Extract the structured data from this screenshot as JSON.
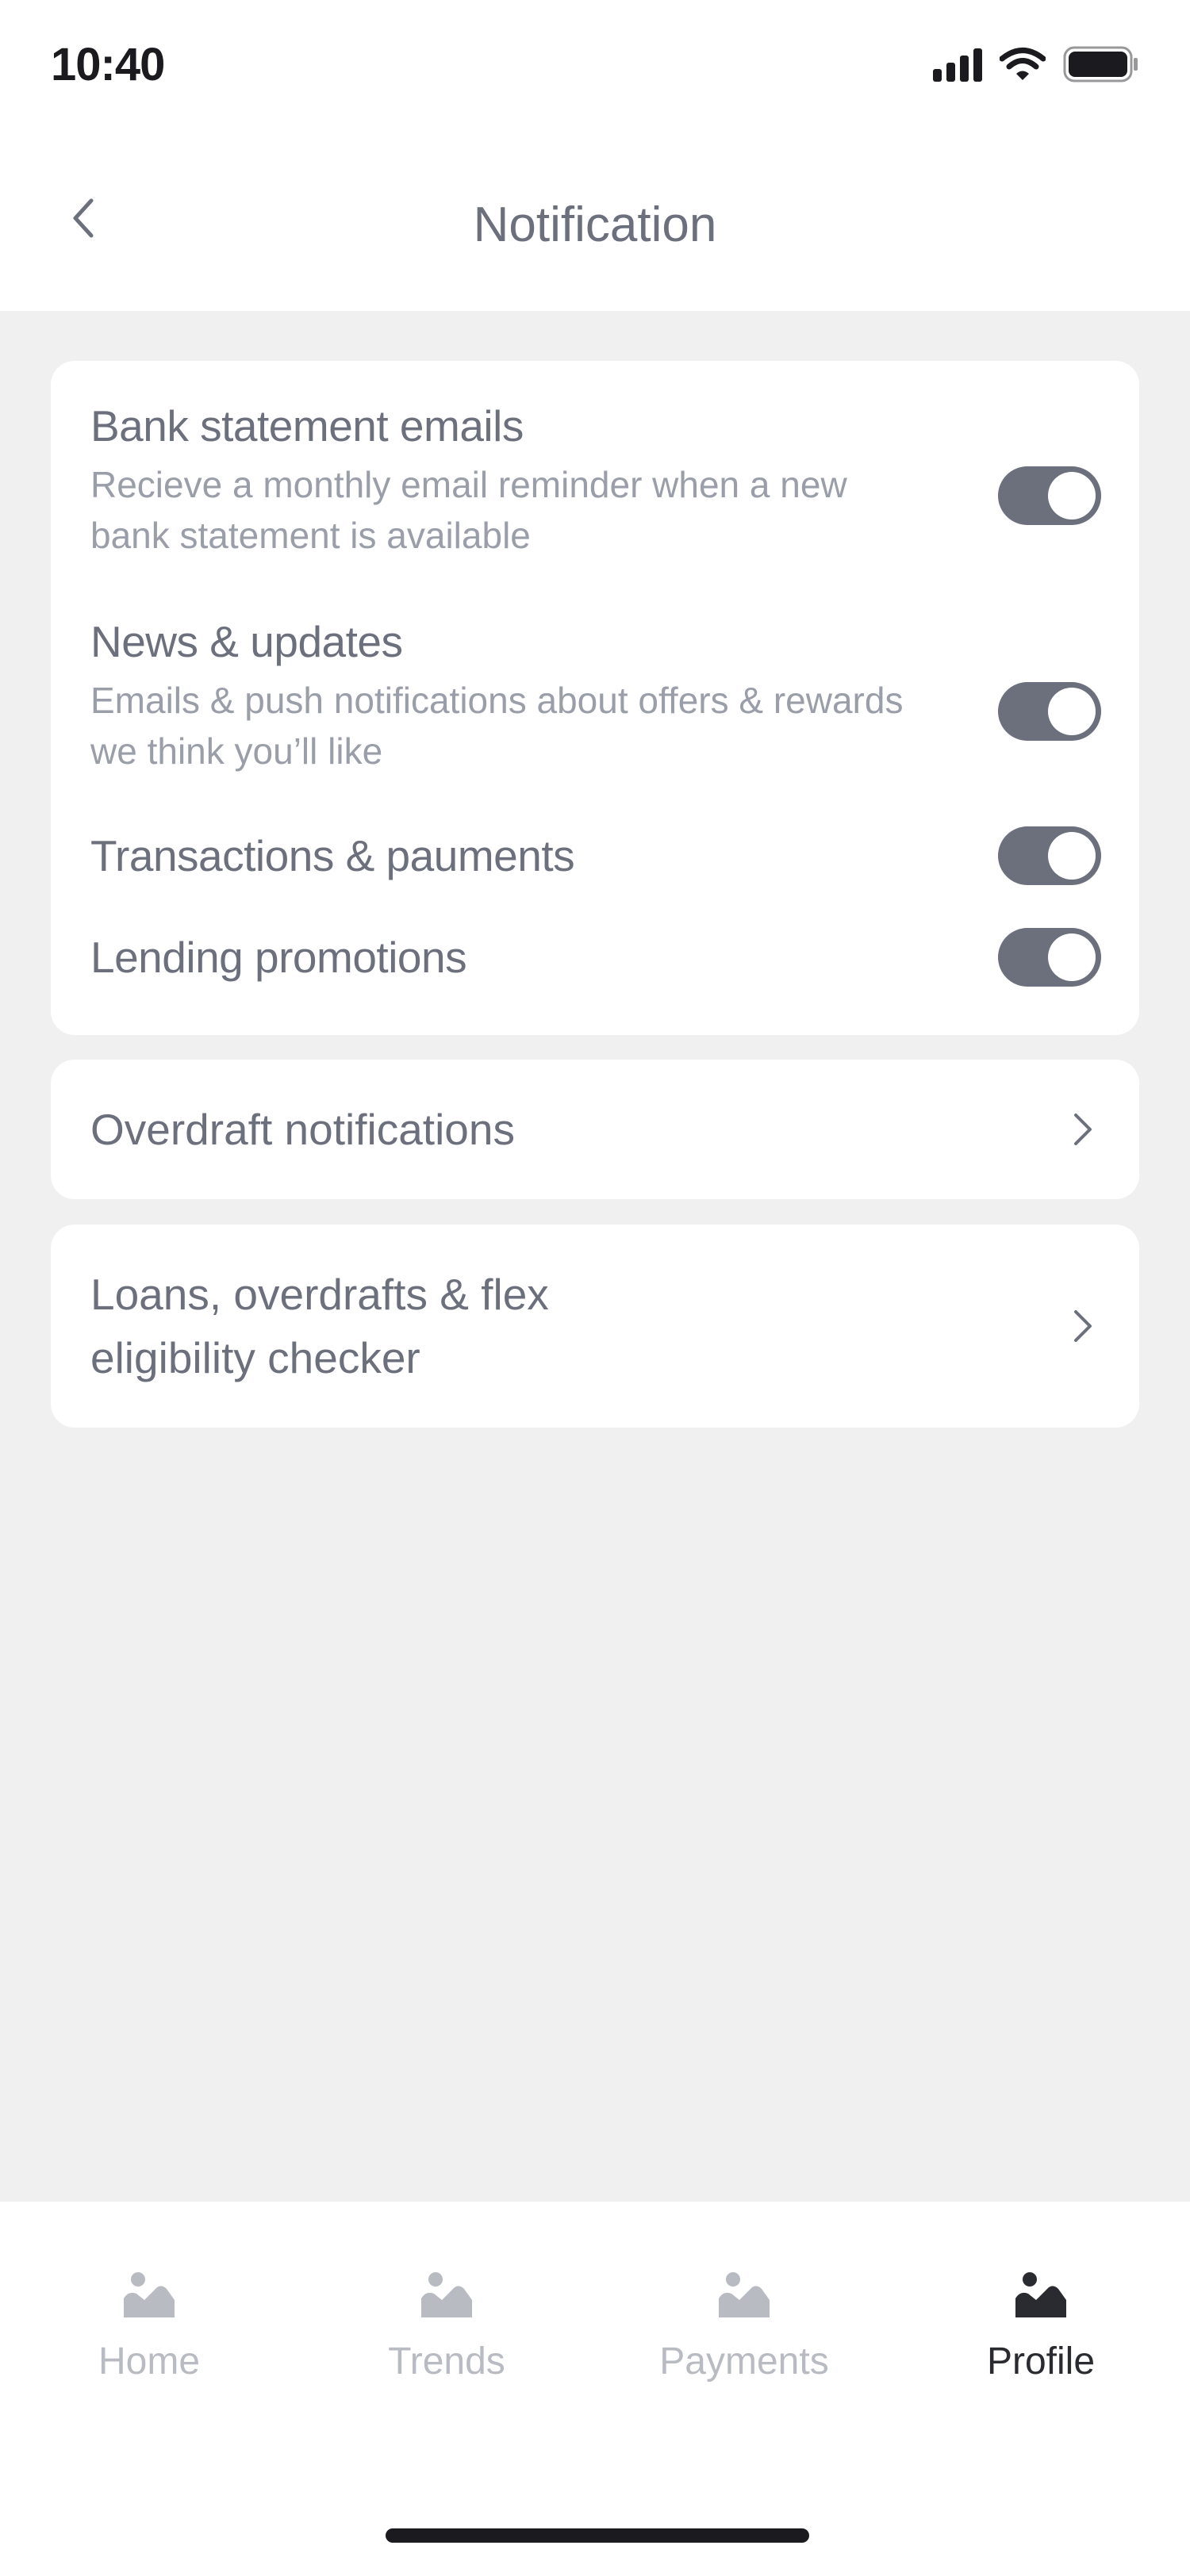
{
  "status_bar": {
    "time": "10:40"
  },
  "header": {
    "title": "Notification"
  },
  "notifications_card": {
    "items": [
      {
        "title": "Bank statement emails",
        "description": "Recieve a monthly email reminder when a new bank statement is available",
        "enabled": true
      },
      {
        "title": "News & updates",
        "description": "Emails & push notifications about offers & rewards we think you’ll like",
        "enabled": true
      },
      {
        "title": "Transactions & pauments",
        "enabled": true
      },
      {
        "title": "Lending promotions",
        "enabled": true
      }
    ]
  },
  "links": [
    {
      "label": "Overdraft notifications"
    },
    {
      "label_line1": "Loans, overdrafts & flex",
      "label_line2": "eligibility checker"
    }
  ],
  "tab_bar": {
    "tabs": [
      {
        "label": "Home",
        "active": false
      },
      {
        "label": "Trends",
        "active": false
      },
      {
        "label": "Payments",
        "active": false
      },
      {
        "label": "Profile",
        "active": true
      }
    ]
  },
  "colors": {
    "background": "#F0F0F0",
    "card": "#FFFFFF",
    "text_primary": "#6C707D",
    "text_secondary": "#9A9EA8",
    "toggle_on": "#6C707D",
    "tab_inactive": "#B8BBC2",
    "tab_active": "#2A2B30"
  },
  "icons": {
    "back": "chevron-left-icon",
    "link": "chevron-right-icon",
    "tab": "image-placeholder-icon",
    "signal": "cellular-signal-icon",
    "wifi": "wifi-icon",
    "battery": "battery-icon"
  }
}
